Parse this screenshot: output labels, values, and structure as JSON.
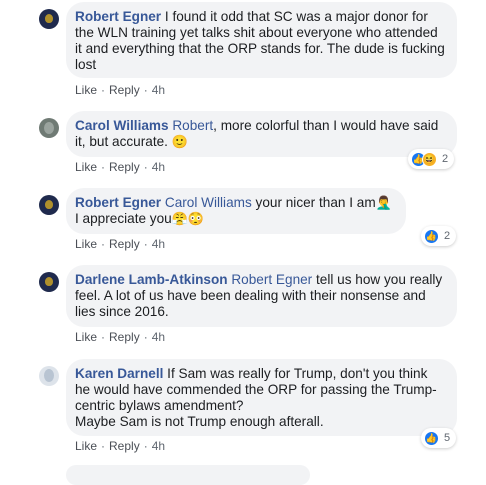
{
  "comments": [
    {
      "author": "Robert Egner",
      "tag": "",
      "text": " I found it odd that SC was a major donor for the WLN training yet talks shit about everyone who attended it and everything that the ORP stands for. The dude is fucking lost",
      "like": "Like",
      "reply": "Reply",
      "time": "4h"
    },
    {
      "author": "Carol Williams",
      "tag": "Robert",
      "text": ", more colorful than I would have said it, but accurate. ",
      "emoji": "🙂",
      "like": "Like",
      "reply": "Reply",
      "time": "4h",
      "reactions": {
        "icons": [
          "like-icon",
          "haha-icon"
        ],
        "count": "2"
      }
    },
    {
      "author": "Robert Egner",
      "tag": "Carol Williams",
      "text": " your nicer than I am",
      "emoji": "🤦‍♂️",
      "text2": " I appreciate you",
      "emoji2": "😤😳",
      "like": "Like",
      "reply": "Reply",
      "time": "4h",
      "reactions": {
        "icons": [
          "like-icon"
        ],
        "count": "2"
      }
    },
    {
      "author": "Darlene Lamb-Atkinson",
      "tag": "Robert Egner",
      "text": " tell us how you really feel. A lot of us have been dealing with their nonsense and lies since 2016.",
      "like": "Like",
      "reply": "Reply",
      "time": "4h"
    },
    {
      "author": "Karen Darnell",
      "tag": "",
      "text": " If Sam was really for Trump, don't you think he would have commended the ORP for passing the Trump-centric bylaws amendment?",
      "text2": "Maybe Sam is not Trump enough afterall.",
      "like": "Like",
      "reply": "Reply",
      "time": "4h",
      "reactions": {
        "icons": [
          "like-icon"
        ],
        "count": "5"
      }
    }
  ],
  "colors": {
    "link": "#385898",
    "bubble": "#f2f3f5",
    "like_blue": "#1877f2",
    "haha_yellow": "#f7b125"
  }
}
